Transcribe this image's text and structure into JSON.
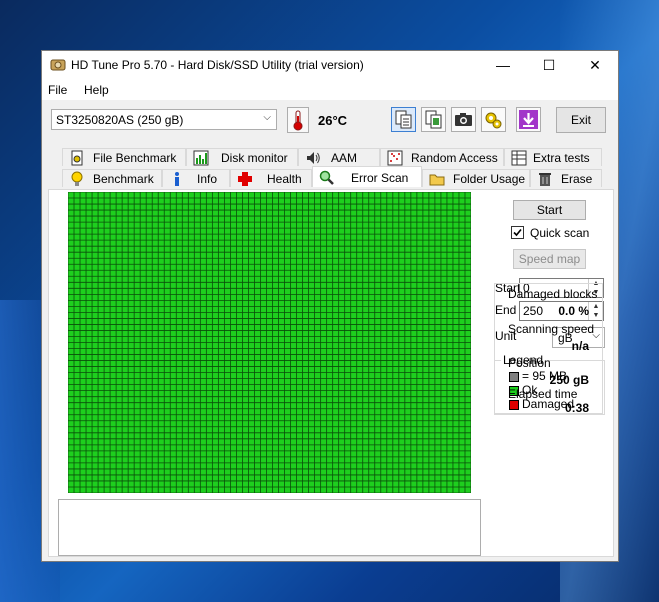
{
  "window": {
    "title": "HD Tune Pro 5.70 - Hard Disk/SSD Utility (trial version)",
    "controls": {
      "minimize": "—",
      "maximize": "☐",
      "close": "✕"
    }
  },
  "menu": {
    "file": "File",
    "help": "Help"
  },
  "toolbar": {
    "drive": "ST3250820AS (250 gB)",
    "temperature": "26°C",
    "exit": "Exit",
    "icons": [
      "copy-text-icon",
      "copy-screenshot-icon",
      "camera-icon",
      "options-icon",
      "save-download-icon"
    ]
  },
  "tabs": {
    "top": [
      "File Benchmark",
      "Disk monitor",
      "AAM",
      "Random Access",
      "Extra tests"
    ],
    "bottom": [
      "Benchmark",
      "Info",
      "Health",
      "Error Scan",
      "Folder Usage",
      "Erase"
    ],
    "selected": "Error Scan"
  },
  "error_scan": {
    "start_button": "Start",
    "quick_scan_label": "Quick scan",
    "quick_scan_checked": true,
    "speed_map_button": "Speed map",
    "start_label": "Start",
    "start_value": "0",
    "end_label": "End",
    "end_value": "250",
    "unit_label": "Unit",
    "unit_value": "gB",
    "legend": {
      "title": "Legend",
      "items": [
        {
          "label": "= 95 MB",
          "color": "#808080"
        },
        {
          "label": "Ok",
          "color": "#1ecf1e"
        },
        {
          "label": "Damaged",
          "color": "#e00000"
        }
      ]
    },
    "stats": {
      "damaged_blocks_label": "Damaged blocks",
      "damaged_blocks_value": "0.0 %",
      "scanning_speed_label": "Scanning speed",
      "scanning_speed_value": "n/a",
      "position_label": "Position",
      "position_value": "250 gB",
      "elapsed_label": "Elapsed time",
      "elapsed_value": "0:38"
    },
    "grid": {
      "columns": 67,
      "rows": 50,
      "block_color": "#1ecf1e",
      "line_color": "#0a4f0a"
    }
  }
}
